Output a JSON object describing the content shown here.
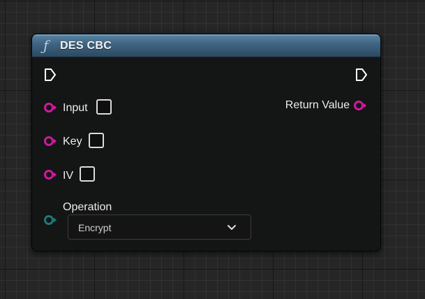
{
  "node": {
    "title": "DES CBC",
    "title_icon": "function-icon",
    "header_color": "#3e6380",
    "inputs": [
      {
        "label": "Input",
        "type": "string",
        "pin_color": "#d0199e"
      },
      {
        "label": "Key",
        "type": "string",
        "pin_color": "#d0199e"
      },
      {
        "label": "IV",
        "type": "string",
        "pin_color": "#d0199e"
      }
    ],
    "operation": {
      "label": "Operation",
      "value": "Encrypt",
      "pin_color": "#1d7a78"
    },
    "outputs": [
      {
        "label": "Return Value",
        "type": "string",
        "pin_color": "#d0199e"
      }
    ]
  }
}
